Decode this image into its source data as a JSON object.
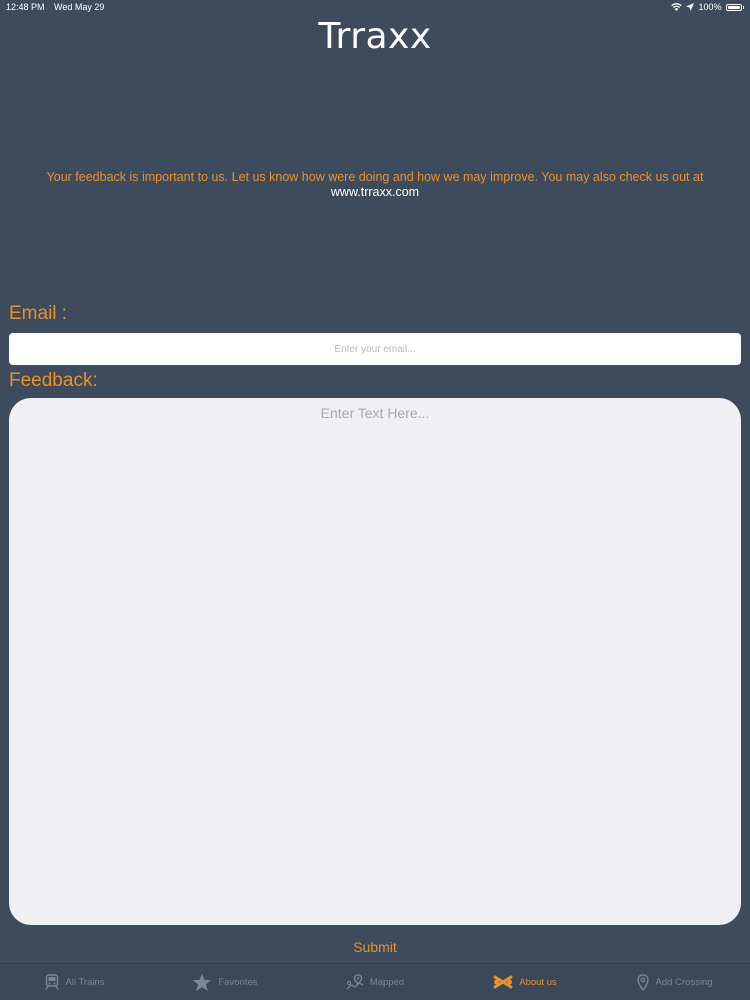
{
  "status_bar": {
    "time": "12:48 PM",
    "date": "Wed May 29",
    "battery": "100%"
  },
  "app": {
    "title": "Trraxx"
  },
  "intro": {
    "text": "Your feedback is important to us. Let us know how were doing and how we may improve. You may also check us out at",
    "link": "www.trraxx.com"
  },
  "form": {
    "email_label": "Email :",
    "email_placeholder": "Enter your email...",
    "email_value": "",
    "feedback_label": "Feedback:",
    "feedback_placeholder": "Enter Text Here...",
    "feedback_value": "",
    "submit_label": "Submit"
  },
  "tab_bar": {
    "tabs": [
      {
        "label": "All Trains",
        "icon": "train-icon",
        "active": false
      },
      {
        "label": "Favorites",
        "icon": "star-icon",
        "active": false
      },
      {
        "label": "Mapped",
        "icon": "map-icon",
        "active": false
      },
      {
        "label": "About us",
        "icon": "crossing-icon",
        "active": true
      },
      {
        "label": "Add Crossing",
        "icon": "location-pin-icon",
        "active": false
      }
    ]
  },
  "colors": {
    "background": "#3d4b5c",
    "accent": "#e8912d",
    "inactive_tab": "#7c8794",
    "text_area": "#efeff4"
  }
}
